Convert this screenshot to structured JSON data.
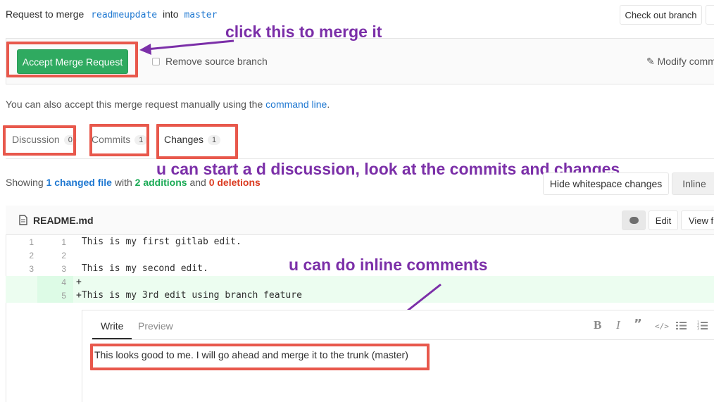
{
  "merge_header": {
    "prefix": "Request to merge",
    "source_branch": "readmeupdate",
    "into": "into",
    "target_branch": "master",
    "checkout_label": "Check out branch"
  },
  "merge_box": {
    "accept_label": "Accept Merge Request",
    "remove_source_label": "Remove source branch",
    "modify_label": "Modify comm"
  },
  "manual": {
    "text": "You can also accept this merge request manually using the",
    "link": "command line",
    "period": "."
  },
  "tabs": [
    {
      "label": "Discussion",
      "count": "0"
    },
    {
      "label": "Commits",
      "count": "1"
    },
    {
      "label": "Changes",
      "count": "1"
    }
  ],
  "summary": {
    "showing": "Showing",
    "changed_files": "1 changed file",
    "with": "with",
    "additions": "2 additions",
    "and": "and",
    "deletions": "0 deletions",
    "whitespace_label": "Hide whitespace changes",
    "inline_label": "Inline"
  },
  "file": {
    "name": "README.md",
    "edit_label": "Edit",
    "view_label": "View fi"
  },
  "diff_lines": [
    {
      "old": "1",
      "new": "1",
      "code": " This is my first gitlab edit."
    },
    {
      "old": "2",
      "new": "2",
      "code": ""
    },
    {
      "old": "3",
      "new": "3",
      "code": " This is my second edit."
    },
    {
      "old": "",
      "new": "4",
      "code": "+"
    },
    {
      "old": "",
      "new": "5",
      "code": "+This is my 3rd edit using branch feature"
    }
  ],
  "comment": {
    "write_tab": "Write",
    "preview_tab": "Preview",
    "text": "This looks good to me.  I will go ahead and merge it to the trunk (master)"
  },
  "annotations": {
    "merge": "click this to merge it",
    "tabs": "u can start a d discussion, look at the commits and changes",
    "inline": "u can do inline comments"
  },
  "colors": {
    "accept_green": "#2faa60",
    "link_blue": "#1f78d1",
    "addition_green": "#1aaa55",
    "deletion_red": "#db3b21",
    "annotation_purple": "#7b2fa8",
    "highlight_red": "#e8584c",
    "added_line_bg": "#ecfdf0"
  }
}
